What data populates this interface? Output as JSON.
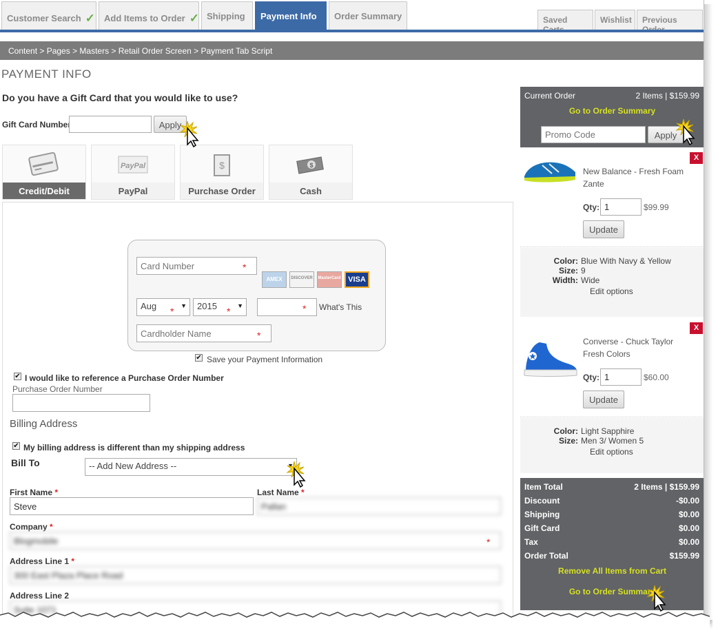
{
  "tabs": [
    {
      "label": "Customer Search",
      "done": true
    },
    {
      "label": "Add Items to Order",
      "done": true
    },
    {
      "label": "Shipping",
      "done": false
    },
    {
      "label": "Payment Info",
      "active": true
    },
    {
      "label": "Order Summary",
      "done": false
    }
  ],
  "right_tabs": [
    "Saved Carts",
    "Wishlist",
    "Previous Order"
  ],
  "breadcrumb": "Content > Pages > Masters > Retail Order Screen > Payment Tab Script",
  "page_title": "PAYMENT INFO",
  "gift_card": {
    "question": "Do you have a Gift Card that you would like to use?",
    "label": "Gift Card Number",
    "value": "",
    "apply": "Apply"
  },
  "payment_methods": [
    {
      "label": "Credit/Debit",
      "icon": "credit-card-icon",
      "selected": true
    },
    {
      "label": "PayPal",
      "icon": "paypal-icon",
      "selected": false
    },
    {
      "label": "Purchase Order",
      "icon": "purchase-order-icon",
      "selected": false
    },
    {
      "label": "Cash",
      "icon": "cash-icon",
      "selected": false
    }
  ],
  "card": {
    "number_placeholder": "Card Number",
    "brands": [
      "AMEX",
      "DISCOVER",
      "MasterCard",
      "VISA"
    ],
    "month": "Aug",
    "year": "2015",
    "whats_this": "What's This",
    "holder_placeholder": "Cardholder Name",
    "save_label": "Save your Payment Information",
    "save_checked": true
  },
  "po": {
    "checkbox_label": "I would like to reference a Purchase Order Number",
    "checked": true,
    "field_label": "Purchase Order Number",
    "value": ""
  },
  "billing": {
    "heading": "Billing Address",
    "different_label": "My billing address is different than my shipping address",
    "different_checked": true,
    "bill_to_label": "Bill To",
    "bill_to_value": "-- Add New Address --",
    "first_name_label": "First Name",
    "first_name": "Steve",
    "last_name_label": "Last Name",
    "last_name": "Pallan",
    "company_label": "Company",
    "company": "Blogmobile",
    "address1_label": "Address Line 1",
    "address1": "300 East Plaza Place Road",
    "address2_label": "Address Line 2",
    "address2": "Suite 1071"
  },
  "order": {
    "title": "Current Order",
    "summary": "2 Items | $159.99",
    "goto_summary": "Go to Order Summary",
    "promo_placeholder": "Promo Code",
    "apply": "Apply",
    "items": [
      {
        "name_line1": "New Balance - Fresh Foam",
        "name_line2": "Zante",
        "qty_label": "Qty:",
        "qty": "1",
        "price": "$99.99",
        "update": "Update",
        "options": [
          {
            "label": "Color:",
            "value": "Blue With Navy & Yellow"
          },
          {
            "label": "Size:",
            "value": "9"
          },
          {
            "label": "Width:",
            "value": "Wide"
          }
        ],
        "edit": "Edit options",
        "remove": "X"
      },
      {
        "name_line1": "Converse - Chuck Taylor",
        "name_line2": "Fresh Colors",
        "qty_label": "Qty:",
        "qty": "1",
        "price": "$60.00",
        "update": "Update",
        "options": [
          {
            "label": "Color:",
            "value": "Light Sapphire"
          },
          {
            "label": "Size:",
            "value": "Men 3/ Women 5"
          }
        ],
        "edit": "Edit options",
        "remove": "X"
      }
    ],
    "totals": [
      {
        "label": "Item Total",
        "value": "2 Items | $159.99"
      },
      {
        "label": "Discount",
        "value": "-$0.00"
      },
      {
        "label": "Shipping",
        "value": "$0.00"
      },
      {
        "label": "Gift Card",
        "value": "$0.00"
      },
      {
        "label": "Tax",
        "value": "$0.00"
      },
      {
        "label": "Order Total",
        "value": "$159.99"
      }
    ],
    "remove_all": "Remove All Items from Cart",
    "goto_summary_bottom": "Go to Order Summary"
  },
  "colors": {
    "accent": "#3c6aa6",
    "panel": "#616366",
    "highlight": "#d6e024",
    "remove": "#c8102e",
    "check": "#6ab04c"
  }
}
